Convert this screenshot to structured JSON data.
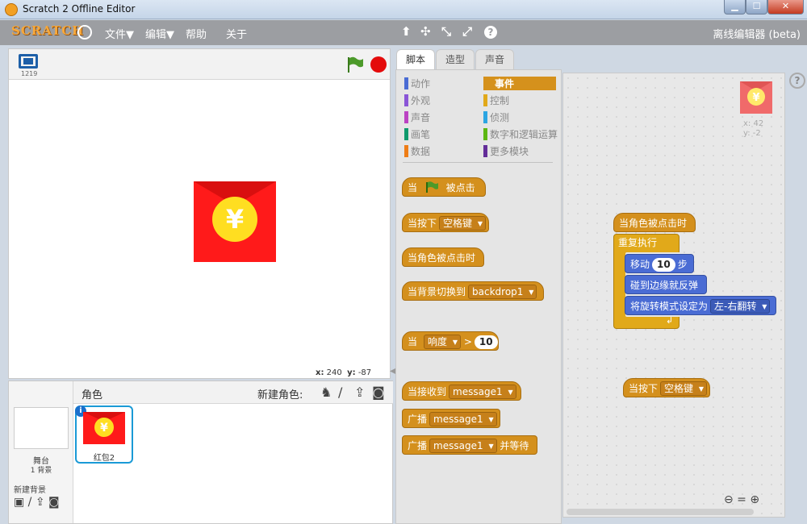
{
  "window": {
    "title": "Scratch 2 Offline Editor",
    "min_symbol": "▁",
    "max_symbol": "☐",
    "close_symbol": "✕"
  },
  "menubar": {
    "logo_text": "SCRATCH",
    "items": [
      "文件▼",
      "编辑▼",
      "帮助",
      "关于"
    ],
    "tools": [
      "⬆",
      "✣",
      "⤡",
      "⤢",
      "?"
    ],
    "offline_label": "离线编辑器 (beta)"
  },
  "stage": {
    "version": "1219",
    "coords": {
      "x_label": "x:",
      "x": "240",
      "y_label": "y:",
      "y": "-87"
    }
  },
  "tabs": [
    "脚本",
    "造型",
    "声音"
  ],
  "categories": {
    "left": [
      {
        "label": "动作",
        "color": "#4a6cd4"
      },
      {
        "label": "外观",
        "color": "#8a55d7"
      },
      {
        "label": "声音",
        "color": "#bb42c3"
      },
      {
        "label": "画笔",
        "color": "#0e9a6c"
      },
      {
        "label": "数据",
        "color": "#ee7d16"
      }
    ],
    "right": [
      {
        "label": "事件",
        "color": "#c88330"
      },
      {
        "label": "控制",
        "color": "#e1a91a"
      },
      {
        "label": "侦测",
        "color": "#2ca5e2"
      },
      {
        "label": "数字和逻辑运算",
        "color": "#5cb712"
      },
      {
        "label": "更多模块",
        "color": "#632d99"
      }
    ]
  },
  "palette_blocks": {
    "when_flag_pre": "当",
    "when_flag_post": "被点击",
    "key_pressed": "当按下",
    "key_value": "空格键",
    "sprite_clicked": "当角色被点击时",
    "backdrop_switch": "当背景切换到",
    "backdrop_value": "backdrop1",
    "when": "当",
    "loudness": "响度",
    "gt": ">",
    "loudness_value": "10",
    "receive": "当接收到",
    "message": "message1",
    "broadcast": "广播",
    "broadcast_wait_post": "并等待"
  },
  "script": {
    "hat": "当角色被点击时",
    "forever": "重复执行",
    "move_pre": "移动",
    "move_value": "10",
    "move_post": "步",
    "bounce": "碰到边缘就反弹",
    "rotation": "将旋转模式设定为",
    "rotation_value": "左-右翻转",
    "loop_arrow": "↲",
    "key_hat": "当按下",
    "key_value": "空格键"
  },
  "canvas_sprite": {
    "x": "x: 42",
    "y": "y: -2"
  },
  "sprites_panel": {
    "label": "角色",
    "new_sprite": "新建角色:",
    "icons": [
      "♞",
      "/",
      "⇪",
      "◙"
    ],
    "stage_label": "舞台",
    "backdrop_count": "1 背景",
    "new_backdrop": "新建背景",
    "backdrop_icons": "▣ / ⇪ ◙",
    "sprite_name": "红包2",
    "info": "i"
  },
  "help": "?",
  "zoom": "⊖ = ⊕",
  "colors": {
    "envelope_red": "#ff1a1a",
    "coin_yellow": "#ffde21",
    "event_orange": "#d4901d",
    "motion_blue": "#4a6cd4",
    "control_gold": "#e1a91a"
  },
  "currency_symbol": "¥"
}
